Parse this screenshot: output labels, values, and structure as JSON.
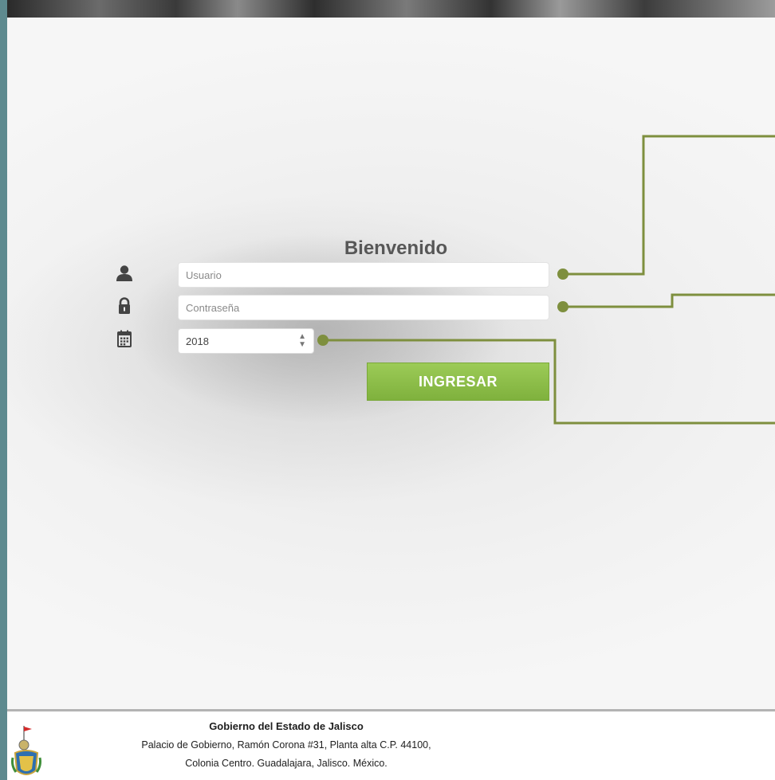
{
  "header": {
    "title": "Bienvenido"
  },
  "login": {
    "username_placeholder": "Usuario",
    "password_placeholder": "Contraseña",
    "year_value": "2018",
    "submit_label": "INGRESAR"
  },
  "icons": {
    "user": "user-icon",
    "password": "lock-icon",
    "year": "calendar-icon"
  },
  "colors": {
    "accent_green": "#8dbf4a",
    "connector_olive": "#7e8f3e",
    "title_gray": "#575757"
  },
  "footer": {
    "organization": "Gobierno del Estado de Jalisco",
    "address_line1": "Palacio de Gobierno, Ramón Corona #31, Planta alta C.P. 44100,",
    "address_line2": "Colonia Centro. Guadalajara, Jalisco. México."
  }
}
